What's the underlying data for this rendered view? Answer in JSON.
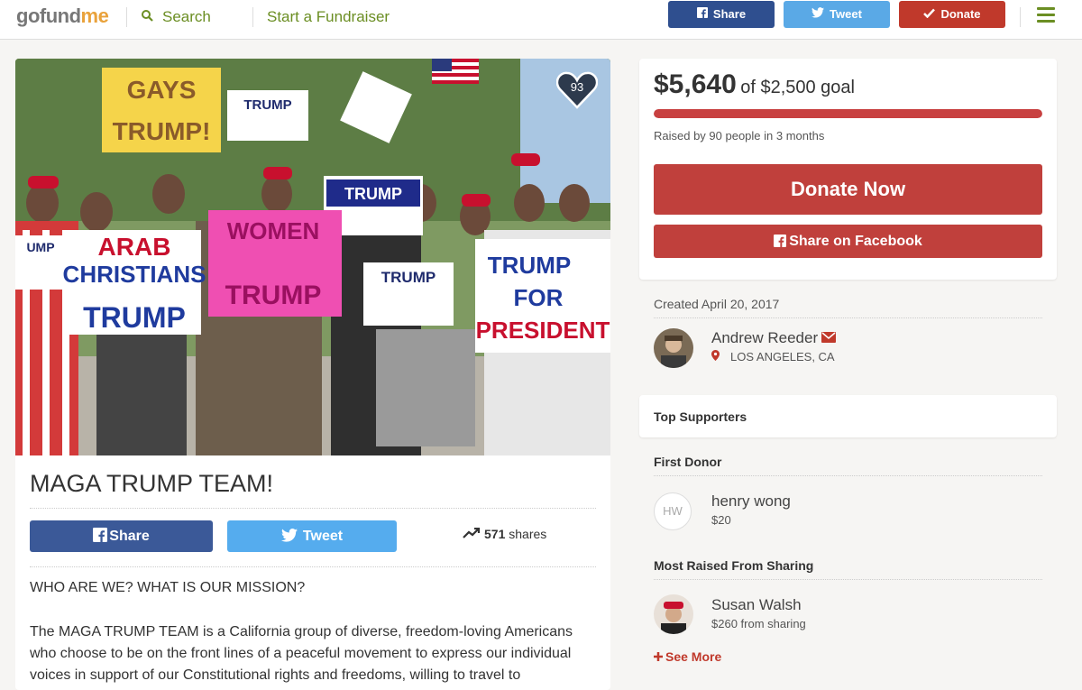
{
  "header": {
    "logo_go": "go",
    "logo_fund": "fund",
    "logo_me": "me",
    "search_label": "Search",
    "start_label": "Start a Fundraiser",
    "share_label": "Share",
    "tweet_label": "Tweet",
    "donate_label": "Donate"
  },
  "campaign": {
    "hearts": "93",
    "title": "MAGA TRUMP TEAM!",
    "share_label": "Share",
    "tweet_label": "Tweet",
    "shares_count": "571",
    "shares_label": "shares",
    "mission_heading": "WHO ARE WE? WHAT IS OUR MISSION?",
    "description": "The MAGA TRUMP TEAM is a California group of diverse, freedom-loving Americans who choose to be on the front lines of a peaceful movement to express our individual voices in support of our Constitutional rights and freedoms, willing to travel to"
  },
  "funding": {
    "amount": "$5,640",
    "goal_text": "of $2,500 goal",
    "progress_fraction": 1.0,
    "raised_by": "Raised by 90 people in 3 months",
    "donate_now_label": "Donate Now",
    "share_facebook_label": "Share on Facebook"
  },
  "organizer": {
    "created": "Created April 20, 2017",
    "name": "Andrew Reeder",
    "location": "LOS ANGELES, CA"
  },
  "supporters": {
    "top_label": "Top Supporters",
    "first_donor_label": "First Donor",
    "first_donor_initials": "HW",
    "first_donor_name": "henry wong",
    "first_donor_amount": "$20",
    "most_sharing_label": "Most Raised From Sharing",
    "sharer_name": "Susan Walsh",
    "sharer_amount": "$260 from sharing",
    "see_more_label": "See More"
  },
  "colors": {
    "brand_green": "#6b8e23",
    "donate_red": "#c0403c",
    "facebook_blue": "#3b5998",
    "twitter_blue": "#55acee"
  },
  "icons": [
    "search-icon",
    "facebook-icon",
    "twitter-icon",
    "check-icon",
    "menu-icon",
    "heart-icon",
    "trending-icon",
    "mail-icon",
    "location-pin-icon",
    "plus-icon"
  ]
}
